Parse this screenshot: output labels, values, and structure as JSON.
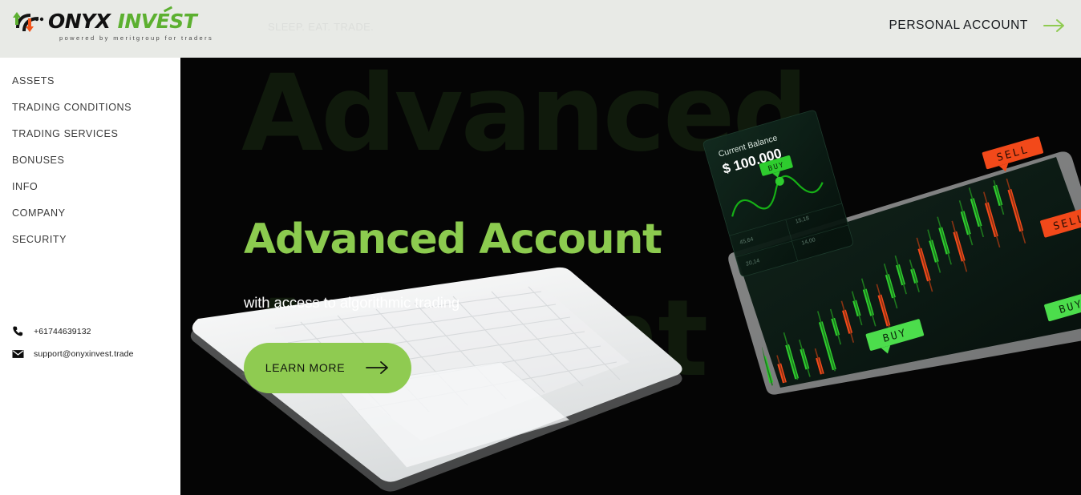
{
  "brand": {
    "name_part1": "ONYX",
    "name_part2": "INVEST",
    "tagline_small": "powered by meritgroup for traders",
    "slogan": "SLEEP. EAT. TRADE.",
    "accent_green": "#8fcb51",
    "logo_green": "#5cb030",
    "header_bg": "#e8eae6",
    "hero_bg": "#050505",
    "ghost_text_color": "#101a0c"
  },
  "header": {
    "account_label": "PERSONAL ACCOUNT",
    "account_arrow_icon": "arrow-right-icon"
  },
  "sidebar": {
    "items": [
      {
        "label": "ASSETS"
      },
      {
        "label": "TRADING CONDITIONS"
      },
      {
        "label": "TRADING SERVICES"
      },
      {
        "label": "BONUSES"
      },
      {
        "label": "INFO"
      },
      {
        "label": "COMPANY"
      },
      {
        "label": "SECURITY"
      }
    ],
    "contacts": {
      "phone_icon": "phone-icon",
      "phone": "+61744639132",
      "email_icon": "envelope-icon",
      "email": "support@onyxinvest.trade"
    }
  },
  "hero": {
    "ghost_line1": "Advanced",
    "ghost_line2": "Account",
    "title": "Advanced Account",
    "subtitle": "with access to algorithmic trading",
    "cta_label": "LEARN MORE",
    "cta_arrow_icon": "arrow-right-icon"
  },
  "artwork": {
    "balance_card": {
      "label": "Current Balance",
      "value": "$ 100.000"
    },
    "signal_labels": {
      "buy": "BUY",
      "sell": "SELL"
    },
    "buy_color": "#2ecc2e",
    "sell_color": "#f2491a",
    "device": "laptop"
  }
}
